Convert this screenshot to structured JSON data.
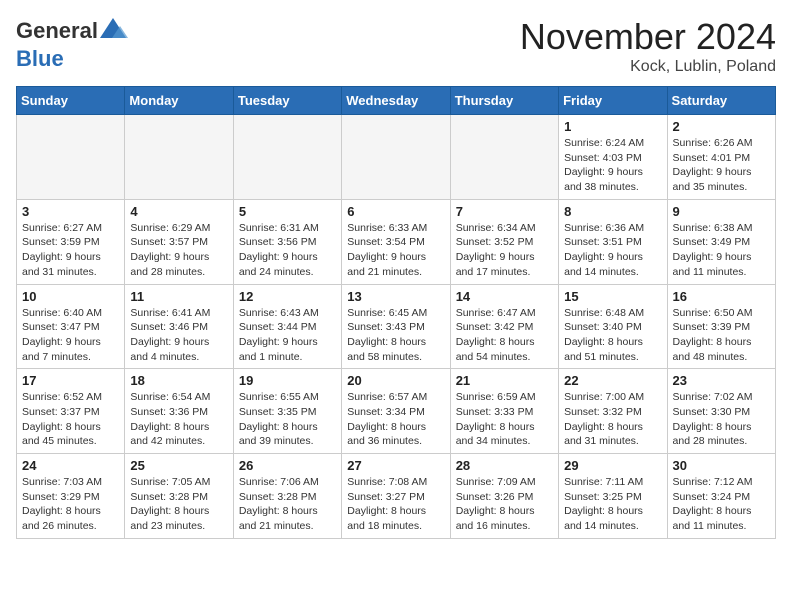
{
  "header": {
    "logo_general": "General",
    "logo_blue": "Blue",
    "month_title": "November 2024",
    "location": "Kock, Lublin, Poland"
  },
  "days_of_week": [
    "Sunday",
    "Monday",
    "Tuesday",
    "Wednesday",
    "Thursday",
    "Friday",
    "Saturday"
  ],
  "weeks": [
    [
      {
        "day": "",
        "info": "",
        "empty": true
      },
      {
        "day": "",
        "info": "",
        "empty": true
      },
      {
        "day": "",
        "info": "",
        "empty": true
      },
      {
        "day": "",
        "info": "",
        "empty": true
      },
      {
        "day": "",
        "info": "",
        "empty": true
      },
      {
        "day": "1",
        "info": "Sunrise: 6:24 AM\nSunset: 4:03 PM\nDaylight: 9 hours\nand 38 minutes."
      },
      {
        "day": "2",
        "info": "Sunrise: 6:26 AM\nSunset: 4:01 PM\nDaylight: 9 hours\nand 35 minutes."
      }
    ],
    [
      {
        "day": "3",
        "info": "Sunrise: 6:27 AM\nSunset: 3:59 PM\nDaylight: 9 hours\nand 31 minutes."
      },
      {
        "day": "4",
        "info": "Sunrise: 6:29 AM\nSunset: 3:57 PM\nDaylight: 9 hours\nand 28 minutes."
      },
      {
        "day": "5",
        "info": "Sunrise: 6:31 AM\nSunset: 3:56 PM\nDaylight: 9 hours\nand 24 minutes."
      },
      {
        "day": "6",
        "info": "Sunrise: 6:33 AM\nSunset: 3:54 PM\nDaylight: 9 hours\nand 21 minutes."
      },
      {
        "day": "7",
        "info": "Sunrise: 6:34 AM\nSunset: 3:52 PM\nDaylight: 9 hours\nand 17 minutes."
      },
      {
        "day": "8",
        "info": "Sunrise: 6:36 AM\nSunset: 3:51 PM\nDaylight: 9 hours\nand 14 minutes."
      },
      {
        "day": "9",
        "info": "Sunrise: 6:38 AM\nSunset: 3:49 PM\nDaylight: 9 hours\nand 11 minutes."
      }
    ],
    [
      {
        "day": "10",
        "info": "Sunrise: 6:40 AM\nSunset: 3:47 PM\nDaylight: 9 hours\nand 7 minutes."
      },
      {
        "day": "11",
        "info": "Sunrise: 6:41 AM\nSunset: 3:46 PM\nDaylight: 9 hours\nand 4 minutes."
      },
      {
        "day": "12",
        "info": "Sunrise: 6:43 AM\nSunset: 3:44 PM\nDaylight: 9 hours\nand 1 minute."
      },
      {
        "day": "13",
        "info": "Sunrise: 6:45 AM\nSunset: 3:43 PM\nDaylight: 8 hours\nand 58 minutes."
      },
      {
        "day": "14",
        "info": "Sunrise: 6:47 AM\nSunset: 3:42 PM\nDaylight: 8 hours\nand 54 minutes."
      },
      {
        "day": "15",
        "info": "Sunrise: 6:48 AM\nSunset: 3:40 PM\nDaylight: 8 hours\nand 51 minutes."
      },
      {
        "day": "16",
        "info": "Sunrise: 6:50 AM\nSunset: 3:39 PM\nDaylight: 8 hours\nand 48 minutes."
      }
    ],
    [
      {
        "day": "17",
        "info": "Sunrise: 6:52 AM\nSunset: 3:37 PM\nDaylight: 8 hours\nand 45 minutes."
      },
      {
        "day": "18",
        "info": "Sunrise: 6:54 AM\nSunset: 3:36 PM\nDaylight: 8 hours\nand 42 minutes."
      },
      {
        "day": "19",
        "info": "Sunrise: 6:55 AM\nSunset: 3:35 PM\nDaylight: 8 hours\nand 39 minutes."
      },
      {
        "day": "20",
        "info": "Sunrise: 6:57 AM\nSunset: 3:34 PM\nDaylight: 8 hours\nand 36 minutes."
      },
      {
        "day": "21",
        "info": "Sunrise: 6:59 AM\nSunset: 3:33 PM\nDaylight: 8 hours\nand 34 minutes."
      },
      {
        "day": "22",
        "info": "Sunrise: 7:00 AM\nSunset: 3:32 PM\nDaylight: 8 hours\nand 31 minutes."
      },
      {
        "day": "23",
        "info": "Sunrise: 7:02 AM\nSunset: 3:30 PM\nDaylight: 8 hours\nand 28 minutes."
      }
    ],
    [
      {
        "day": "24",
        "info": "Sunrise: 7:03 AM\nSunset: 3:29 PM\nDaylight: 8 hours\nand 26 minutes."
      },
      {
        "day": "25",
        "info": "Sunrise: 7:05 AM\nSunset: 3:28 PM\nDaylight: 8 hours\nand 23 minutes."
      },
      {
        "day": "26",
        "info": "Sunrise: 7:06 AM\nSunset: 3:28 PM\nDaylight: 8 hours\nand 21 minutes."
      },
      {
        "day": "27",
        "info": "Sunrise: 7:08 AM\nSunset: 3:27 PM\nDaylight: 8 hours\nand 18 minutes."
      },
      {
        "day": "28",
        "info": "Sunrise: 7:09 AM\nSunset: 3:26 PM\nDaylight: 8 hours\nand 16 minutes."
      },
      {
        "day": "29",
        "info": "Sunrise: 7:11 AM\nSunset: 3:25 PM\nDaylight: 8 hours\nand 14 minutes."
      },
      {
        "day": "30",
        "info": "Sunrise: 7:12 AM\nSunset: 3:24 PM\nDaylight: 8 hours\nand 11 minutes."
      }
    ]
  ]
}
